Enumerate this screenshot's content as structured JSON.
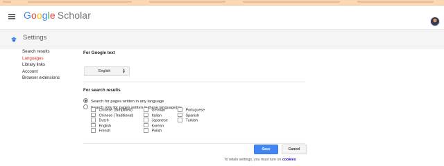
{
  "header": {
    "logo_google": [
      "G",
      "o",
      "o",
      "g",
      "l",
      "e"
    ],
    "logo_product": "Scholar"
  },
  "subheader": {
    "title": "Settings"
  },
  "sidebar": {
    "items": [
      {
        "label": "Search results",
        "active": false
      },
      {
        "label": "Languages",
        "active": true
      },
      {
        "label": "Library links",
        "active": false
      },
      {
        "label": "Account",
        "active": false
      },
      {
        "label": "Browser extensions",
        "active": false
      }
    ]
  },
  "google_text": {
    "title": "For Google text",
    "selected_language": "English"
  },
  "search_results": {
    "title": "For search results",
    "option_any": "Search for pages written in any language",
    "option_specific": "Search only for pages written in these language(s):",
    "selected_option": "any",
    "languages": {
      "col1": [
        "Chinese (Simplified)",
        "Chinese (Traditional)",
        "Dutch",
        "English",
        "French"
      ],
      "col2": [
        "German",
        "Italian",
        "Japanese",
        "Korean",
        "Polish"
      ],
      "col3": [
        "Portuguese",
        "Spanish",
        "Turkish"
      ]
    }
  },
  "actions": {
    "save_label": "Save",
    "cancel_label": "Cancel"
  },
  "footer": {
    "retain_text": "To retain settings, you must turn on",
    "cookies_link": "cookies"
  },
  "colors": {
    "accent": "#4285f4",
    "active_link": "#d93025",
    "background_frame": "#fbd7b4"
  }
}
